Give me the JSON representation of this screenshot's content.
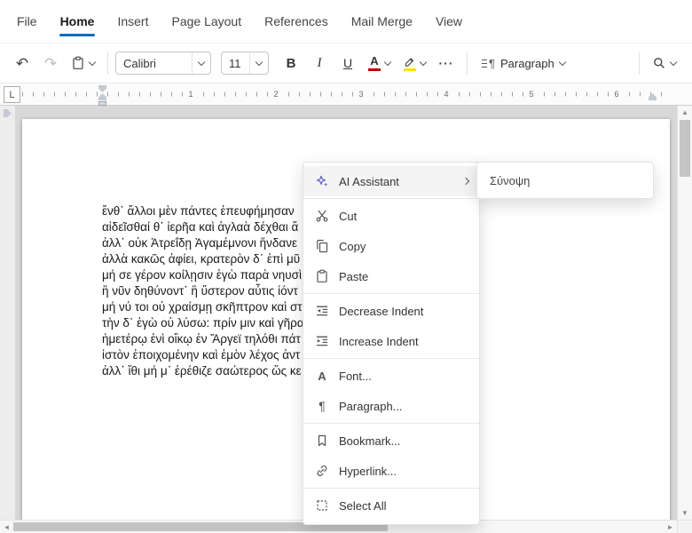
{
  "menubar": {
    "items": [
      {
        "label": "File"
      },
      {
        "label": "Home"
      },
      {
        "label": "Insert"
      },
      {
        "label": "Page Layout"
      },
      {
        "label": "References"
      },
      {
        "label": "Mail Merge"
      },
      {
        "label": "View"
      }
    ]
  },
  "toolbar": {
    "font_name": "Calibri",
    "font_size": "11",
    "bold": "B",
    "italic": "I",
    "underline": "U",
    "font_color": "A",
    "more": "···",
    "paragraph_label": "Paragraph"
  },
  "ruler": {
    "tab_selector": "L",
    "numbers": [
      "1",
      "2",
      "3",
      "4",
      "5",
      "6"
    ]
  },
  "document": {
    "lines": [
      "ἔνθ᾽ ἄλλοι μὲν πάντες ἐπευφήμησαν",
      "αἰδεῖσθαί θ᾽ ἱερῆα καὶ ἀγλαὰ δέχθαι ἄ",
      "ἀλλ᾽ οὐκ Ἀτρεΐδῃ Ἀγαμέμνονι ἥνδανε",
      "ἀλλὰ κακῶς ἀφίει, κρατερὸν δ᾽ ἐπὶ μῦ",
      "μή σε γέρον κοίλῃσιν ἐγὼ παρὰ νηυσὶ",
      "ἢ νῦν δηθύνοντ᾽ ἢ ὕστερον αὖτις ἰόντ",
      "μή νύ τοι οὐ χραίσμῃ σκῆπτρον καὶ στ",
      "τὴν δ᾽ ἐγὼ οὐ λύσω: πρίν μιν καὶ γῆρα",
      "ἡμετέρῳ ἐνὶ οἴκῳ ἐν Ἄργεϊ τηλόθι πάτ",
      "ἱστὸν ἐποιχομένην καὶ ἐμὸν λέχος ἀντ",
      "ἀλλ᾽ ἴθι μή μ᾽ ἐρέθιζε σαώτερος ὥς κε"
    ]
  },
  "context_menu": {
    "items": [
      {
        "label": "AI Assistant",
        "icon": "ai-sparkle-icon",
        "has_submenu": true,
        "highlighted": true
      },
      {
        "label": "Cut",
        "icon": "scissors-icon"
      },
      {
        "label": "Copy",
        "icon": "copy-icon"
      },
      {
        "label": "Paste",
        "icon": "paste-icon"
      },
      {
        "label": "Decrease Indent",
        "icon": "decrease-indent-icon"
      },
      {
        "label": "Increase Indent",
        "icon": "increase-indent-icon"
      },
      {
        "label": "Font...",
        "icon": "font-icon"
      },
      {
        "label": "Paragraph...",
        "icon": "paragraph-mark-icon"
      },
      {
        "label": "Bookmark...",
        "icon": "bookmark-icon"
      },
      {
        "label": "Hyperlink...",
        "icon": "hyperlink-icon"
      },
      {
        "label": "Select All",
        "icon": "select-all-icon"
      }
    ],
    "submenu": {
      "items": [
        {
          "label": "Σύνοψη"
        }
      ]
    }
  },
  "colors": {
    "accent": "#0f6cbd",
    "ai": "#5b5fc7",
    "font_color_bar": "#c00000",
    "highlight_bar": "#ffe100"
  }
}
